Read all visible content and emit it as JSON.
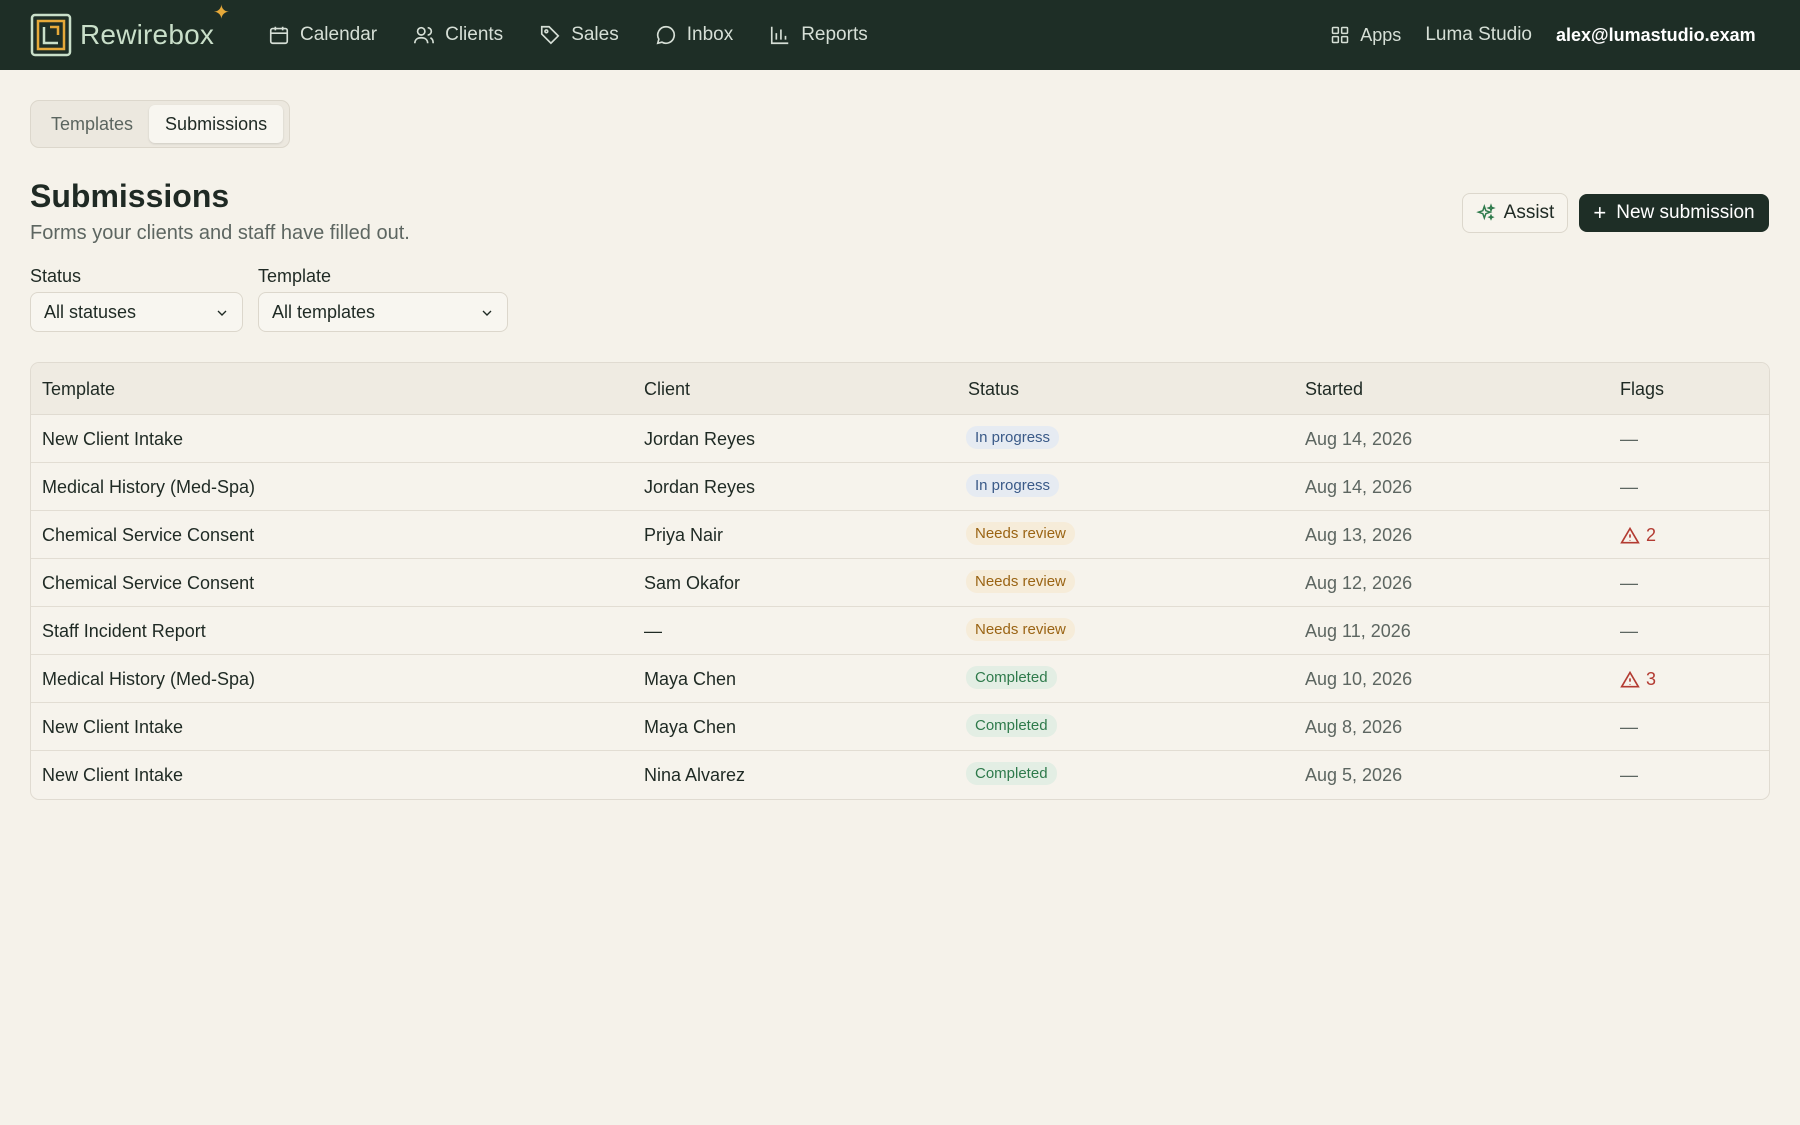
{
  "brand": {
    "name": "Rewirebox",
    "colors": {
      "topbar": "#1e2e26",
      "accent": "#e6a93a",
      "brand_text": "#c9dfc9"
    }
  },
  "nav": {
    "items": [
      {
        "label": "Calendar",
        "icon": "calendar-icon"
      },
      {
        "label": "Clients",
        "icon": "users-icon"
      },
      {
        "label": "Sales",
        "icon": "tag-icon"
      },
      {
        "label": "Inbox",
        "icon": "chat-bubble-icon"
      },
      {
        "label": "Reports",
        "icon": "bar-chart-icon"
      }
    ],
    "apps_label": "Apps",
    "studio_label": "Luma Studio",
    "user_email": "alex@lumastudio.exam..."
  },
  "tabs": [
    {
      "label": "Templates",
      "active": false
    },
    {
      "label": "Submissions",
      "active": true
    }
  ],
  "header": {
    "title": "Submissions",
    "subtitle": "Forms your clients and staff have filled out.",
    "assist_label": "Assist",
    "new_label": "New submission"
  },
  "filters": {
    "status": {
      "label": "Status",
      "value": "All statuses"
    },
    "template": {
      "label": "Template",
      "value": "All templates"
    }
  },
  "table": {
    "columns": [
      "Template",
      "Client",
      "Status",
      "Started",
      "Flags"
    ],
    "rows": [
      {
        "template": "New Client Intake",
        "client": "Jordan Reyes",
        "status": "In progress",
        "status_kind": "progress",
        "started": "Aug 14, 2026",
        "flags": "—",
        "flag_count": null
      },
      {
        "template": "Medical History (Med-Spa)",
        "client": "Jordan Reyes",
        "status": "In progress",
        "status_kind": "progress",
        "started": "Aug 14, 2026",
        "flags": "—",
        "flag_count": null
      },
      {
        "template": "Chemical Service Consent",
        "client": "Priya Nair",
        "status": "Needs review",
        "status_kind": "review",
        "started": "Aug 13, 2026",
        "flags": "2",
        "flag_count": 2
      },
      {
        "template": "Chemical Service Consent",
        "client": "Sam Okafor",
        "status": "Needs review",
        "status_kind": "review",
        "started": "Aug 12, 2026",
        "flags": "—",
        "flag_count": null
      },
      {
        "template": "Staff Incident Report",
        "client": "—",
        "status": "Needs review",
        "status_kind": "review",
        "started": "Aug 11, 2026",
        "flags": "—",
        "flag_count": null
      },
      {
        "template": "Medical History (Med-Spa)",
        "client": "Maya Chen",
        "status": "Completed",
        "status_kind": "done",
        "started": "Aug 10, 2026",
        "flags": "3",
        "flag_count": 3
      },
      {
        "template": "New Client Intake",
        "client": "Maya Chen",
        "status": "Completed",
        "status_kind": "done",
        "started": "Aug 8, 2026",
        "flags": "—",
        "flag_count": null
      },
      {
        "template": "New Client Intake",
        "client": "Nina Alvarez",
        "status": "Completed",
        "status_kind": "done",
        "started": "Aug 5, 2026",
        "flags": "—",
        "flag_count": null
      }
    ]
  }
}
